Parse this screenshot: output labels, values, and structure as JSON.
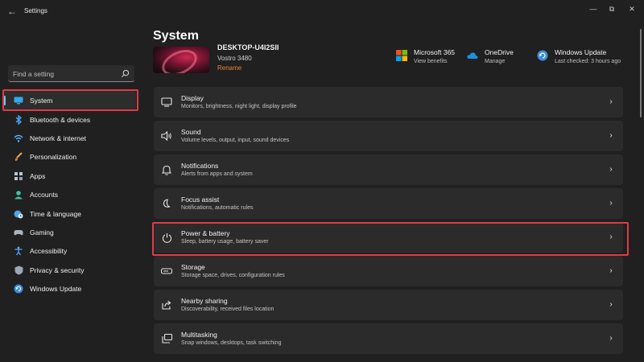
{
  "window": {
    "title": "Settings",
    "back_icon": "back-arrow-icon",
    "controls": [
      "minimize-icon",
      "maximize-icon",
      "close-icon"
    ]
  },
  "search": {
    "placeholder": "Find a setting"
  },
  "sidebar": {
    "items": [
      {
        "label": "System",
        "icon": "monitor-icon",
        "active": true
      },
      {
        "label": "Bluetooth & devices",
        "icon": "bluetooth-icon"
      },
      {
        "label": "Network & internet",
        "icon": "wifi-icon"
      },
      {
        "label": "Personalization",
        "icon": "brush-icon"
      },
      {
        "label": "Apps",
        "icon": "apps-icon"
      },
      {
        "label": "Accounts",
        "icon": "person-icon"
      },
      {
        "label": "Time & language",
        "icon": "globe-clock-icon"
      },
      {
        "label": "Gaming",
        "icon": "gamepad-icon"
      },
      {
        "label": "Accessibility",
        "icon": "accessibility-icon"
      },
      {
        "label": "Privacy & security",
        "icon": "shield-icon"
      },
      {
        "label": "Windows Update",
        "icon": "update-icon"
      }
    ]
  },
  "header": {
    "title": "System",
    "device": {
      "name": "DESKTOP-U4I2SII",
      "model": "Vostro 3480",
      "rename": "Rename"
    },
    "quick_links": [
      {
        "title": "Microsoft 365",
        "sub": "View benefits",
        "icon": "microsoft-logo-icon"
      },
      {
        "title": "OneDrive",
        "sub": "Manage",
        "icon": "cloud-icon"
      },
      {
        "title": "Windows Update",
        "sub": "Last checked: 3 hours ago",
        "icon": "update-icon"
      }
    ]
  },
  "cards": [
    {
      "title": "Display",
      "sub": "Monitors, brightness, night light, display profile",
      "icon": "display-icon"
    },
    {
      "title": "Sound",
      "sub": "Volume levels, output, input, sound devices",
      "icon": "speaker-icon"
    },
    {
      "title": "Notifications",
      "sub": "Alerts from apps and system",
      "icon": "bell-icon"
    },
    {
      "title": "Focus assist",
      "sub": "Notifications, automatic rules",
      "icon": "moon-icon"
    },
    {
      "title": "Power & battery",
      "sub": "Sleep, battery usage, battery saver",
      "icon": "power-icon"
    },
    {
      "title": "Storage",
      "sub": "Storage space, drives, configuration rules",
      "icon": "storage-icon"
    },
    {
      "title": "Nearby sharing",
      "sub": "Discoverability, received files location",
      "icon": "share-icon"
    },
    {
      "title": "Multitasking",
      "sub": "Snap windows, desktops, task switching",
      "icon": "multitask-icon"
    }
  ],
  "colors": {
    "accent": "#60cdff",
    "highlight": "#e03a45",
    "rename_link": "#e3843e",
    "background": "#202020",
    "card": "#2b2b2b"
  }
}
